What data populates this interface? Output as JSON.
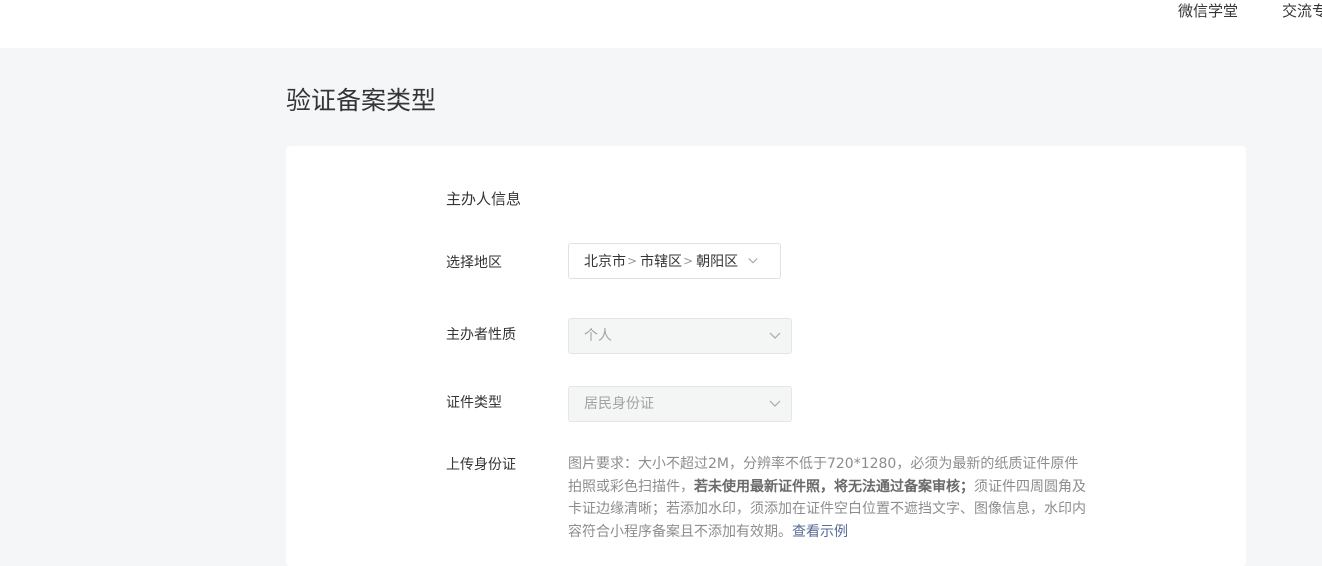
{
  "header": {
    "nav_items": [
      {
        "label": "微信学堂"
      },
      {
        "label": "交流专区"
      }
    ]
  },
  "page": {
    "title": "验证备案类型"
  },
  "form": {
    "section_title": "主办人信息",
    "region": {
      "label": "选择地区",
      "province": "北京市",
      "city": "市辖区",
      "district": "朝阳区",
      "separator": ">"
    },
    "organizer_type": {
      "label": "主办者性质",
      "value": "个人"
    },
    "id_type": {
      "label": "证件类型",
      "value": "居民身份证"
    },
    "upload_id": {
      "label": "上传身份证",
      "requirement_part1": "图片要求：大小不超过2M，分辨率不低于720*1280，必须为最新的纸质证件原件拍照或彩色扫描件，",
      "requirement_bold": "若未使用最新证件照，将无法通过备案审核；",
      "requirement_part2": "须证件四周圆角及卡证边缘清晰；若添加水印，须添加在证件空白位置不遮挡文字、图像信息，水印内容符合小程序备案且不添加有效期。",
      "example_link": "查看示例"
    }
  }
}
